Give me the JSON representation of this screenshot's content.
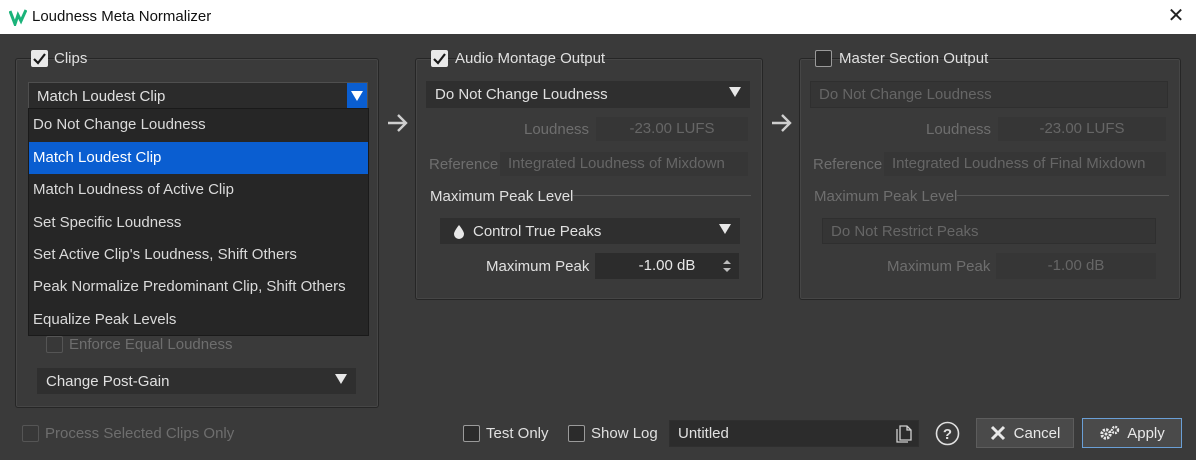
{
  "window": {
    "title": "Loudness Meta Normalizer"
  },
  "clips": {
    "label": "Clips",
    "checked": true,
    "selected": "Match Loudest Clip",
    "options": [
      "Do Not Change Loudness",
      "Match Loudest Clip",
      "Match Loudness of Active Clip",
      "Set Specific Loudness",
      "Set Active Clip's Loudness, Shift Others",
      "Peak Normalize Predominant Clip, Shift Others",
      "Equalize Peak Levels"
    ],
    "enforce_label": "Enforce Equal Loudness",
    "gain_combo": "Change Post-Gain"
  },
  "montage": {
    "label": "Audio Montage Output",
    "checked": true,
    "loudness_combo": "Do Not Change Loudness",
    "loudness_label": "Loudness",
    "loudness_value": "-23.00 LUFS",
    "reference_label": "Reference",
    "reference_value": "Integrated Loudness of Mixdown",
    "peak_section": "Maximum Peak Level",
    "peak_combo": "Control True Peaks",
    "max_peak_label": "Maximum Peak",
    "max_peak_value": "-1.00 dB"
  },
  "master": {
    "label": "Master Section Output",
    "checked": false,
    "loudness_combo": "Do Not Change Loudness",
    "loudness_label": "Loudness",
    "loudness_value": "-23.00 LUFS",
    "reference_label": "Reference",
    "reference_value": "Integrated Loudness of Final Mixdown",
    "peak_section": "Maximum Peak Level",
    "peak_combo": "Do Not Restrict Peaks",
    "max_peak_label": "Maximum Peak",
    "max_peak_value": "-1.00 dB"
  },
  "bottom": {
    "process_selected": "Process Selected Clips Only",
    "test_only": "Test Only",
    "show_log": "Show Log",
    "log_name": "Untitled",
    "cancel": "Cancel",
    "apply": "Apply"
  },
  "icons": {
    "arrow_right": "arrow-right-icon",
    "help": "help-icon",
    "close": "close-icon",
    "drop": "drop-icon",
    "gears": "gears-icon",
    "x": "x-icon"
  },
  "colors": {
    "accent": "#0a5ed1",
    "background": "#3a3a3a"
  }
}
